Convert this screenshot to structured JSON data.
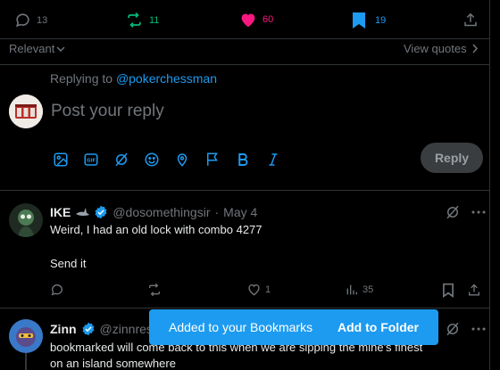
{
  "actions": {
    "replies": "13",
    "reposts": "11",
    "likes": "60",
    "bookmarks": "19"
  },
  "sort": {
    "label": "Relevant",
    "view_quotes": "View quotes"
  },
  "composer": {
    "replying_prefix": "Replying to",
    "replying_handle": "@pokerchessman",
    "placeholder": "Post your reply",
    "reply_button": "Reply"
  },
  "replies": [
    {
      "name": "IKE",
      "handle": "@dosomethingsir",
      "sep": "·",
      "date": "May 4",
      "line1": "Weird, I had an old lock with combo 4277",
      "line2": "Send it",
      "likes": "1",
      "views": "35"
    },
    {
      "name": "Zinn",
      "handle": "@zinnres",
      "line1": "bookmarked will come back to this when we are sipping the mine's finest",
      "line2": "on an island somewhere"
    }
  ],
  "toast": {
    "message": "Added to your Bookmarks",
    "action": "Add to Folder"
  },
  "colors": {
    "accent": "#1d9bf0",
    "like": "#f91880",
    "repost": "#00ba7c",
    "muted": "#71767b"
  }
}
